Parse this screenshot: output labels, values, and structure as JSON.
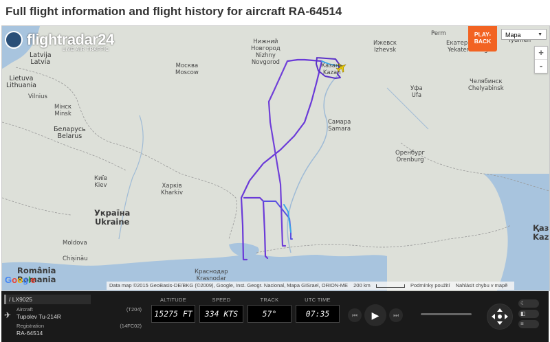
{
  "page_title": "Full flight information and flight history for aircraft RA-64514",
  "map": {
    "logo_text": "flightradar24",
    "logo_sub": "LIVE AIR TRAFFIC",
    "playback_label": "PLAY-\nBACK",
    "map_type": "Mapa",
    "zoom_in": "+",
    "zoom_out": "-",
    "google_logo": "Google",
    "attribution": "Data map ©2015 GeoBasis-DE/BKG (©2009), Google, Inst. Geogr. Nacional, Mapa GISrael, ORION-ME",
    "scale_label": "200 km",
    "terms_label": "Podmínky použití",
    "report_label": "Nahlásit chybu v mapě",
    "labels": [
      {
        "id": "latvia",
        "text": "Latvija\nLatvia"
      },
      {
        "id": "lithuania",
        "text": "Lietuva\nLithuania"
      },
      {
        "id": "vilnius",
        "text": "Vilnius"
      },
      {
        "id": "minsk",
        "text": "Мінск\nMinsk"
      },
      {
        "id": "belarus",
        "text": "Беларусь\nBelarus"
      },
      {
        "id": "moscow",
        "text": "Москва\nMoscow"
      },
      {
        "id": "novgorod",
        "text": "Нижний\nНовгород\nNizhny\nNovgorod"
      },
      {
        "id": "kazan",
        "text": "Казань\nKazan"
      },
      {
        "id": "izhevsk",
        "text": "Ижевск\nIzhevsk"
      },
      {
        "id": "perm",
        "text": "Perm"
      },
      {
        "id": "yekaterinburg",
        "text": "Екатеринбург\nYekaterinburg"
      },
      {
        "id": "tyumen",
        "text": "Tyumen"
      },
      {
        "id": "ufa",
        "text": "Уфа\nUfa"
      },
      {
        "id": "chelyabinsk",
        "text": "Челябинск\nChelyabinsk"
      },
      {
        "id": "samara",
        "text": "Самара\nSamara"
      },
      {
        "id": "orenburg",
        "text": "Оренбург\nOrenburg"
      },
      {
        "id": "kyiv",
        "text": "Київ\nKiev"
      },
      {
        "id": "kharkiv",
        "text": "Харків\nKharkiv"
      },
      {
        "id": "ukraine",
        "text": "Україна\nUkraine"
      },
      {
        "id": "moldova",
        "text": "Moldova"
      },
      {
        "id": "chisinau",
        "text": "Chișinău"
      },
      {
        "id": "romania",
        "text": "România\nRomania"
      },
      {
        "id": "krasnodar",
        "text": "Краснодар\nKrasnodar"
      },
      {
        "id": "kaz",
        "text": "Қаз\nKaz"
      }
    ]
  },
  "panel": {
    "flight_id": "/ LX9025",
    "aircraft_label": "Aircraft",
    "aircraft_value": "Tupolev Tu-214R",
    "aircraft_code": "(T204)",
    "registration_label": "Registration",
    "registration_value": "RA-64514",
    "registration_code": "(14FC02)",
    "stats": [
      {
        "id": "altitude",
        "label": "ALTITUDE",
        "value": "15275 FT"
      },
      {
        "id": "speed",
        "label": "SPEED",
        "value": "334 KTS"
      },
      {
        "id": "track",
        "label": "TRACK",
        "value": "57°"
      },
      {
        "id": "utc",
        "label": "UTC TIME",
        "value": "07:35"
      }
    ],
    "prev_icon": "⏮",
    "play_icon": "▶",
    "next_icon": "⏭"
  },
  "colors": {
    "track_main": "#6a3ad8",
    "track_light": "#3aa6e8",
    "playback": "#f26322",
    "panel_bg": "#1a1a1a"
  }
}
